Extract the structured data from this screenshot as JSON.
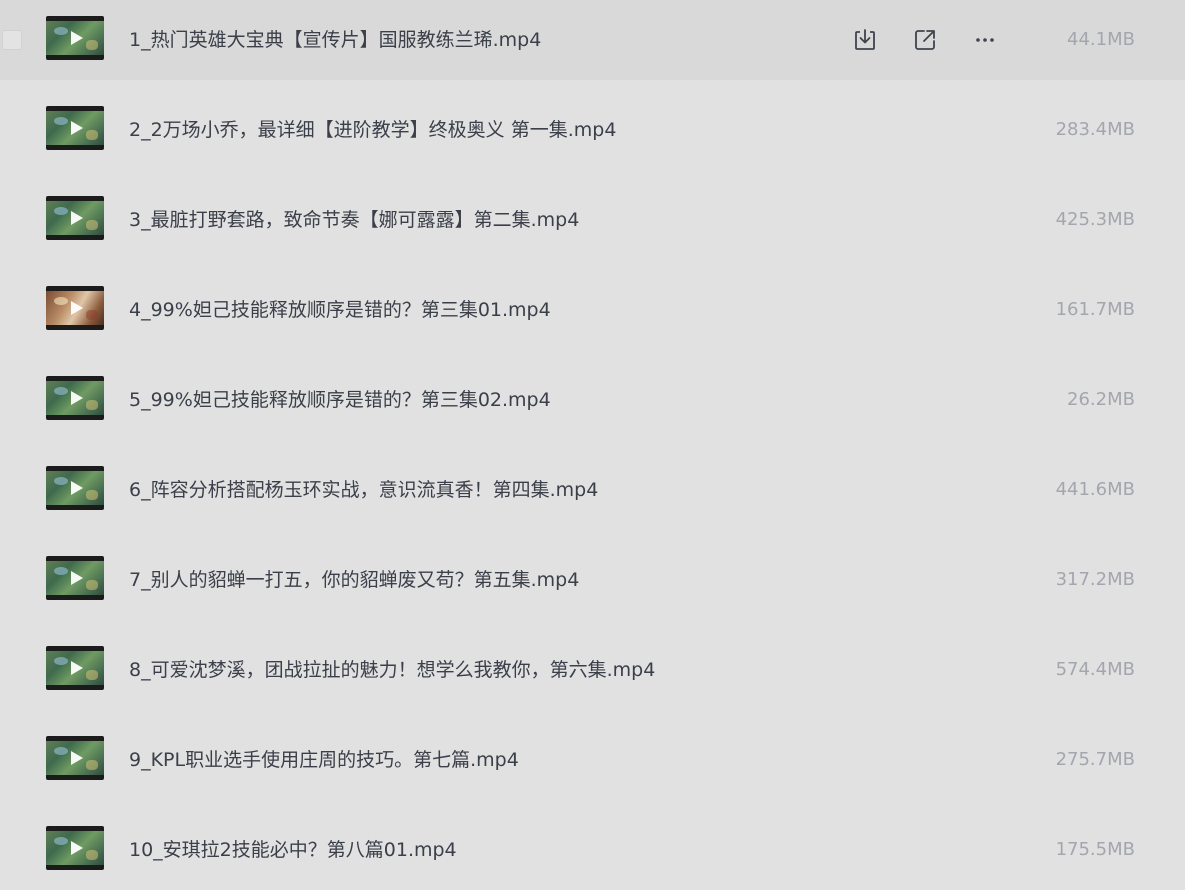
{
  "files": [
    {
      "name": "1_热门英雄大宝典【宣传片】国服教练兰琋.mp4",
      "size": "44.1MB"
    },
    {
      "name": "2_2万场小乔，最详细【进阶教学】终极奥义 第一集.mp4",
      "size": "283.4MB"
    },
    {
      "name": "3_最脏打野套路，致命节奏【娜可露露】第二集.mp4",
      "size": "425.3MB"
    },
    {
      "name": "4_99%妲己技能释放顺序是错的？第三集01.mp4",
      "size": "161.7MB"
    },
    {
      "name": "5_99%妲己技能释放顺序是错的？第三集02.mp4",
      "size": "26.2MB"
    },
    {
      "name": "6_阵容分析搭配杨玉环实战，意识流真香！第四集.mp4",
      "size": "441.6MB"
    },
    {
      "name": "7_别人的貂蝉一打五，你的貂蝉废又苟？第五集.mp4",
      "size": "317.2MB"
    },
    {
      "name": "8_可爱沈梦溪，团战拉扯的魅力！想学么我教你，第六集.mp4",
      "size": "574.4MB"
    },
    {
      "name": "9_KPL职业选手使用庄周的技巧。第七篇.mp4",
      "size": "275.7MB"
    },
    {
      "name": "10_安琪拉2技能必中？第八篇01.mp4",
      "size": "175.5MB"
    }
  ],
  "row_actions": {
    "icons": [
      "download-icon",
      "share-icon",
      "more-icon"
    ]
  }
}
